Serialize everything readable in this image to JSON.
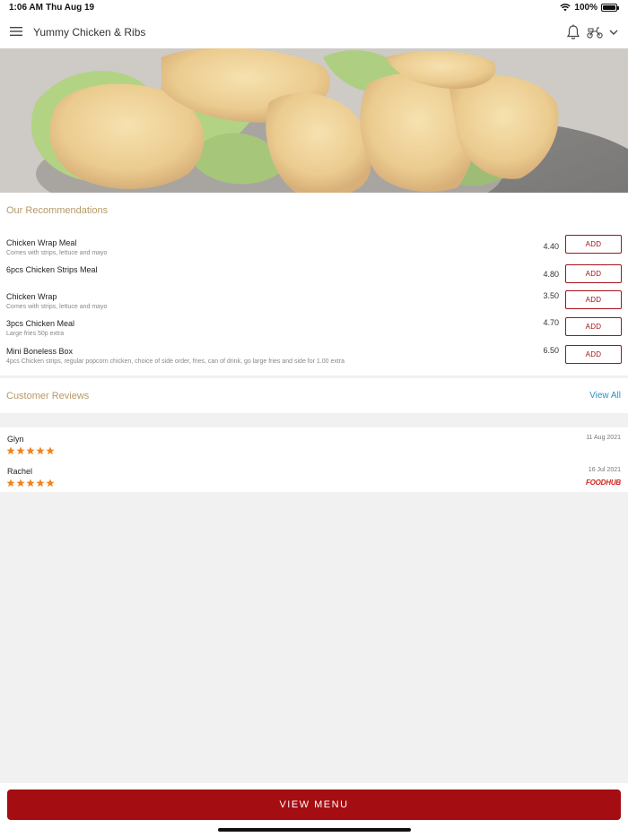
{
  "status_bar": {
    "time": "1:06 AM",
    "date": "Thu Aug 19",
    "battery": "100%"
  },
  "header": {
    "title": "Yummy Chicken & Ribs",
    "icons": [
      "menu-icon",
      "bell-icon",
      "delivery-scooter-icon",
      "chevron-down-icon"
    ]
  },
  "hero": {
    "image": "fried chicken strips on lettuce"
  },
  "recommendations": {
    "title": "Our Recommendations",
    "items": [
      {
        "name": "Chicken Wrap Meal",
        "description": "Comes with strips, lettuce and mayo",
        "price": "4.40",
        "button": "ADD"
      },
      {
        "name": "6pcs Chicken Strips Meal",
        "description": "",
        "price": "4.80",
        "button": "ADD"
      },
      {
        "name": "Chicken Wrap",
        "description": "Comes with strips, lettuce and mayo",
        "price": "3.50",
        "button": "ADD"
      },
      {
        "name": "3pcs Chicken Meal",
        "description": "Large fries 50p extra",
        "price": "4.70",
        "button": "ADD"
      },
      {
        "name": "Mini Boneless Box",
        "description": "4pcs Chicken strips, regular popcorn chicken, choice of side order, fries, can of drink, go large fries and side for 1.00 extra",
        "price": "6.50",
        "button": "ADD"
      }
    ]
  },
  "reviews": {
    "title": "Customer Reviews",
    "view_all": "View All",
    "items": [
      {
        "name": "Glyn",
        "date": "11 Aug 2021",
        "stars": 5
      },
      {
        "name": "Rachel",
        "date": "16 Jul 2021",
        "stars": 5,
        "source": "FOODHUB"
      }
    ]
  },
  "footer": {
    "button": "VIEW MENU"
  },
  "colors": {
    "accent": "#a40d12",
    "section_title": "#b59a68",
    "link": "#2d91c4",
    "star": "#f0821e"
  }
}
